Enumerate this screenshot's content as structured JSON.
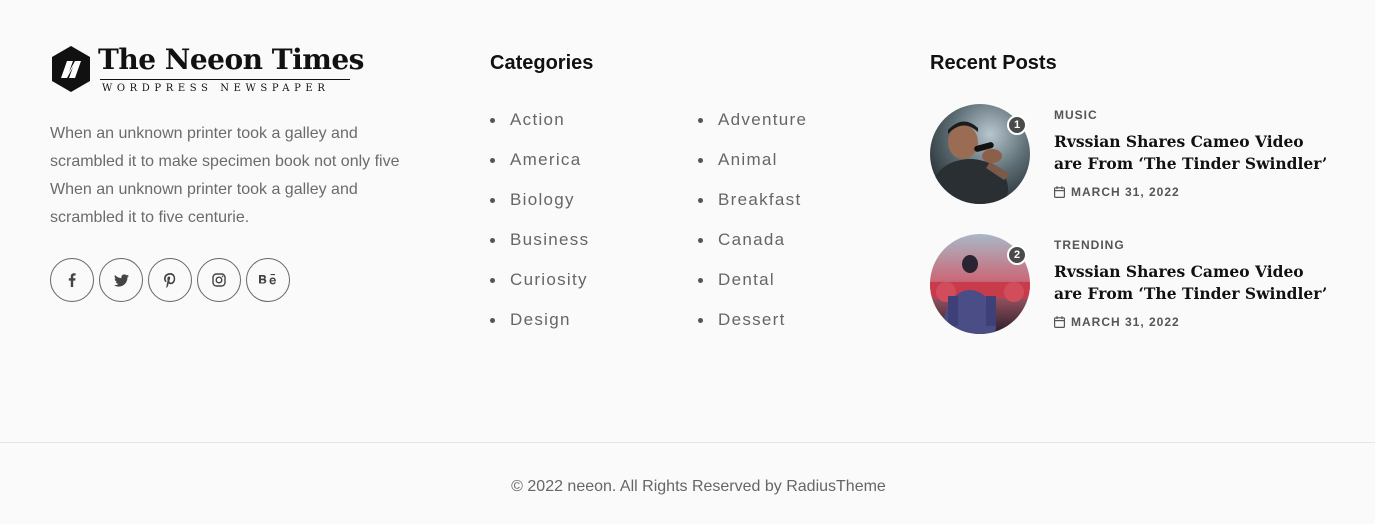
{
  "brand": {
    "title": "The Neeon Times",
    "subtitle": "WORDPRESS NEWSPAPER",
    "about": "When an unknown printer took a galley and scrambled it to make specimen book not only five When an unknown printer took a galley and scrambled it to five centurie.",
    "socials": [
      "facebook-icon",
      "twitter-icon",
      "pinterest-icon",
      "instagram-icon",
      "behance-icon"
    ]
  },
  "categories": {
    "title": "Categories",
    "items": [
      "Action",
      "Adventure",
      "America",
      "Animal",
      "Biology",
      "Breakfast",
      "Business",
      "Canada",
      "Curiosity",
      "Dental",
      "Design",
      "Dessert"
    ]
  },
  "recent": {
    "title": "Recent Posts",
    "posts": [
      {
        "badge": "1",
        "category": "MUSIC",
        "title": "Rvssian Shares Cameo Video are From ‘The Tinder Swindler’",
        "date": "MARCH 31, 2022"
      },
      {
        "badge": "2",
        "category": "TRENDING",
        "title": "Rvssian Shares Cameo Video are From ‘The Tinder Swindler’",
        "date": "MARCH 31, 2022"
      }
    ]
  },
  "footer": {
    "copyright": "© 2022 neeon. All Rights Reserved by RadiusTheme"
  }
}
